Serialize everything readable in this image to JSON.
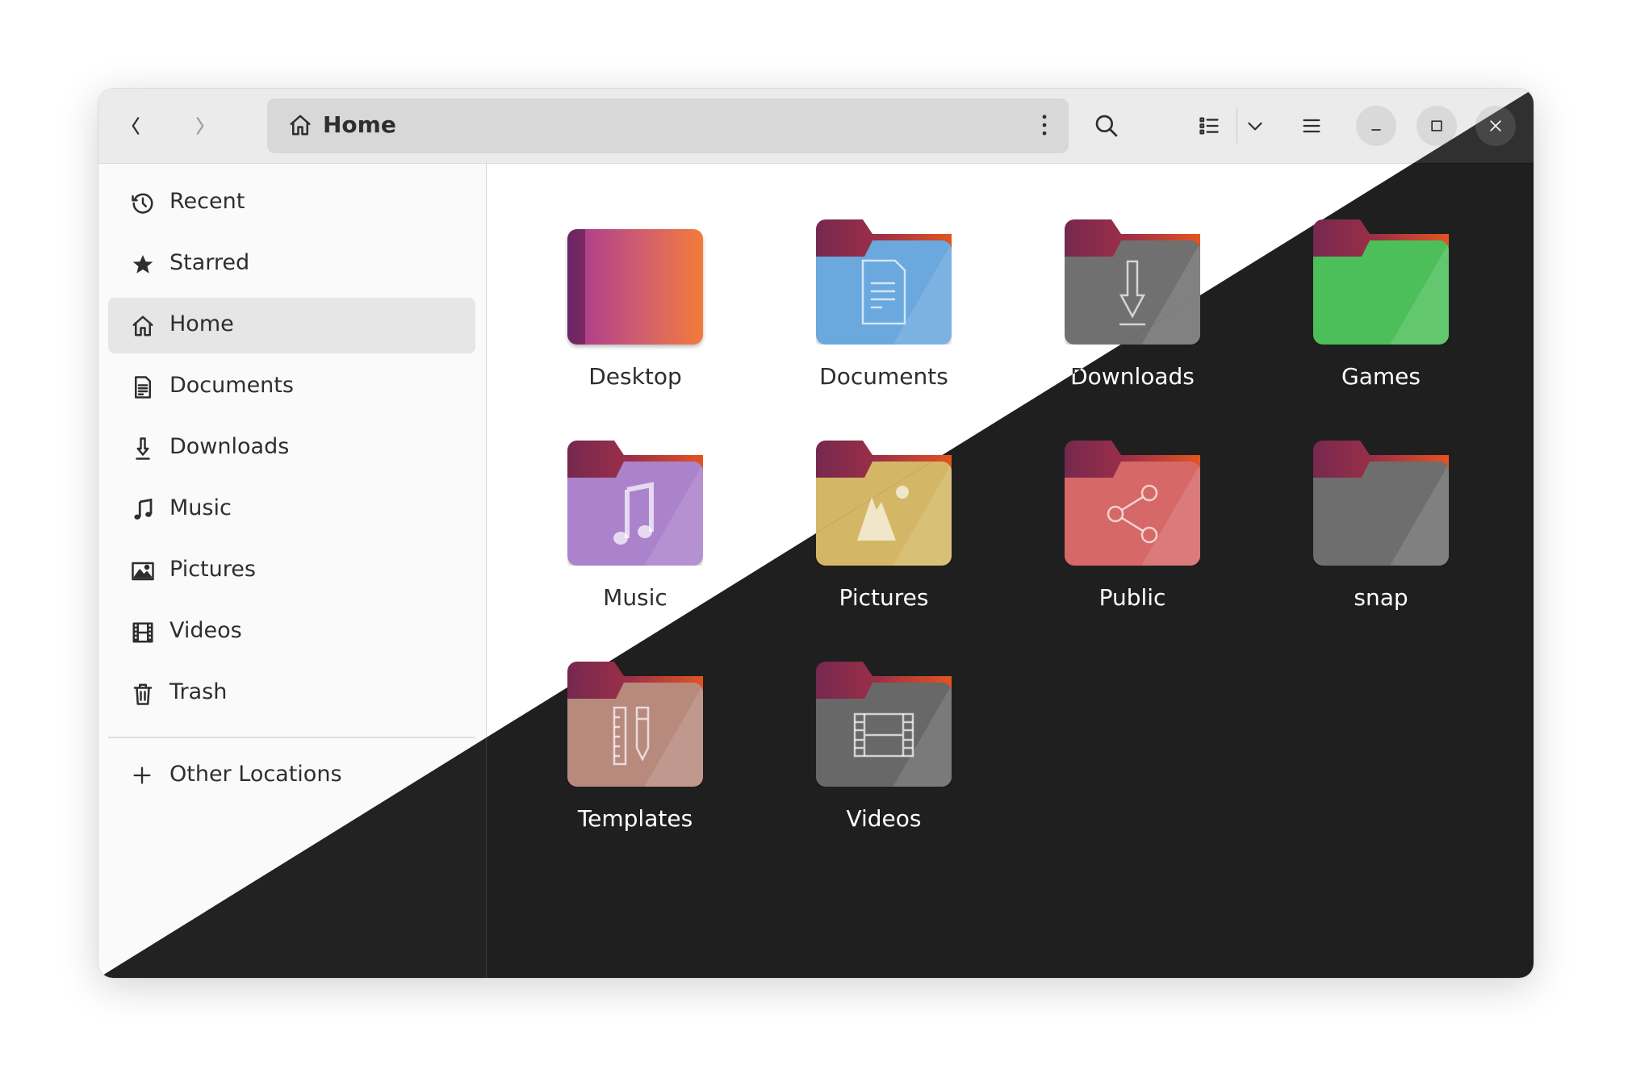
{
  "header": {
    "back_icon": "chevron-left-icon",
    "forward_icon": "chevron-right-icon",
    "location": "Home",
    "location_icon": "home-icon",
    "path_menu_icon": "kebab-menu-icon",
    "search_icon": "search-icon",
    "view_icon": "list-view-icon",
    "view_options_icon": "chevron-down-icon",
    "main_menu_icon": "hamburger-menu-icon",
    "minimize_icon": "minimize-icon",
    "maximize_icon": "maximize-icon",
    "close_icon": "close-icon"
  },
  "sidebar": {
    "selected": "Home",
    "items": [
      {
        "label": "Recent",
        "icon": "clock-icon"
      },
      {
        "label": "Starred",
        "icon": "star-icon"
      },
      {
        "label": "Home",
        "icon": "home-icon"
      },
      {
        "label": "Documents",
        "icon": "document-icon"
      },
      {
        "label": "Downloads",
        "icon": "download-icon"
      },
      {
        "label": "Music",
        "icon": "music-note-icon"
      },
      {
        "label": "Pictures",
        "icon": "picture-icon"
      },
      {
        "label": "Videos",
        "icon": "film-icon"
      },
      {
        "label": "Trash",
        "icon": "trash-icon"
      }
    ],
    "other_locations": {
      "label": "Other Locations",
      "icon": "plus-icon"
    }
  },
  "files": [
    {
      "name": "Desktop",
      "glyph": "desktop",
      "color": "#d05f6e"
    },
    {
      "name": "Documents",
      "glyph": "document",
      "color": "#6aa8de"
    },
    {
      "name": "Downloads",
      "glyph": "download",
      "color": "#707070"
    },
    {
      "name": "Games",
      "glyph": "none",
      "color": "#4cbf5a"
    },
    {
      "name": "Music",
      "glyph": "music",
      "color": "#ab82cc"
    },
    {
      "name": "Pictures",
      "glyph": "picture",
      "color": "#d4b766"
    },
    {
      "name": "Public",
      "glyph": "share",
      "color": "#d66868"
    },
    {
      "name": "snap",
      "glyph": "none",
      "color": "#6e6e6e"
    },
    {
      "name": "Templates",
      "glyph": "template",
      "color": "#b88a7e"
    },
    {
      "name": "Videos",
      "glyph": "film",
      "color": "#686868"
    }
  ],
  "theme": {
    "light_bg": "#ffffff",
    "dark_bg": "#1f1f1f",
    "folder_accent": "#e95420"
  }
}
